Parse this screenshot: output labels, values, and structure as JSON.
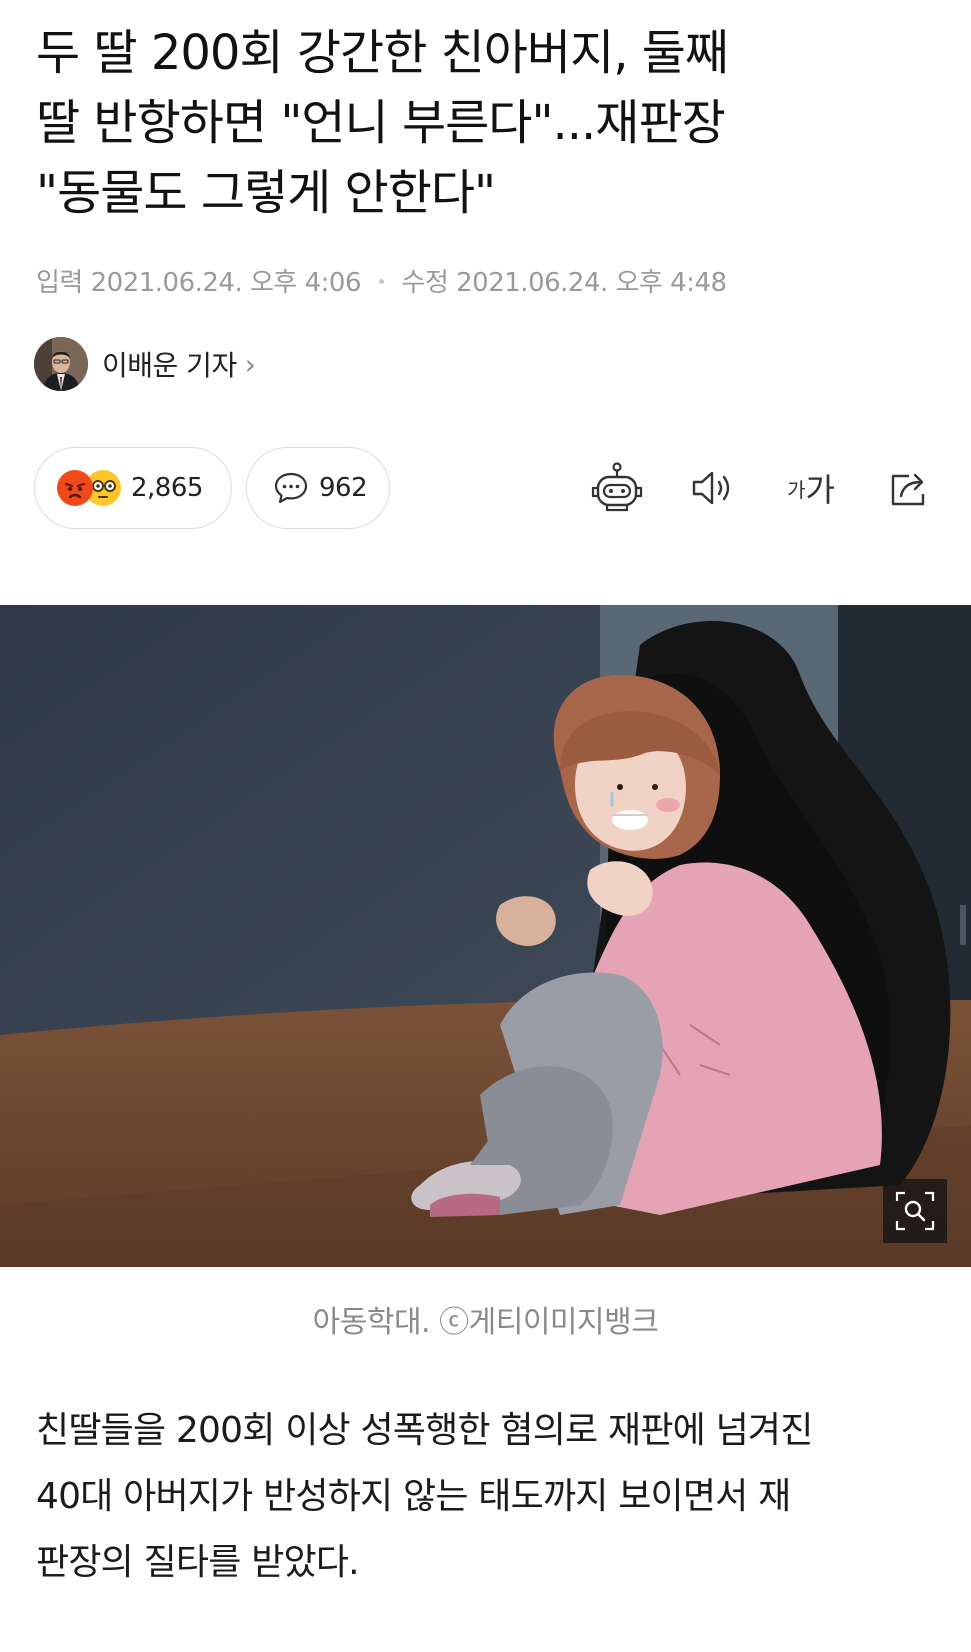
{
  "article": {
    "headline_lines": [
      "두 딸 200회 강간한 친아버지, 둘째",
      "딸 반항하면 \"언니 부른다\"...재판장",
      "\"동물도 그렇게 안한다\""
    ],
    "meta": {
      "published_label": "입력",
      "published": "2021.06.24. 오후 4:06",
      "modified_label": "수정",
      "modified": "2021.06.24. 오후 4:48"
    },
    "author": {
      "name": "이배운 기자",
      "chevron": "›"
    },
    "reactions": {
      "count": "2,865",
      "icons": [
        "angry-face",
        "glasses-face"
      ]
    },
    "comments": {
      "count": "962"
    },
    "toolbar": {
      "font_small": "가",
      "font_big": "가",
      "icons": [
        "robot-summary",
        "speaker",
        "font-size",
        "share"
      ]
    },
    "image": {
      "caption": "아동학대. ⓒ게티이미지뱅크",
      "colors": {
        "wall": "#3a4452",
        "floor": "#6e4a33",
        "sweater": "#e5a3b6",
        "hair": "#a8674a",
        "shadow": "#141414"
      }
    },
    "body_lines": [
      "친딸들을 200회 이상 성폭행한 혐의로 재판에 넘겨진",
      "40대 아버지가 반성하지 않는 태도까지 보이면서 재",
      "판장의 질타를 받았다."
    ]
  }
}
